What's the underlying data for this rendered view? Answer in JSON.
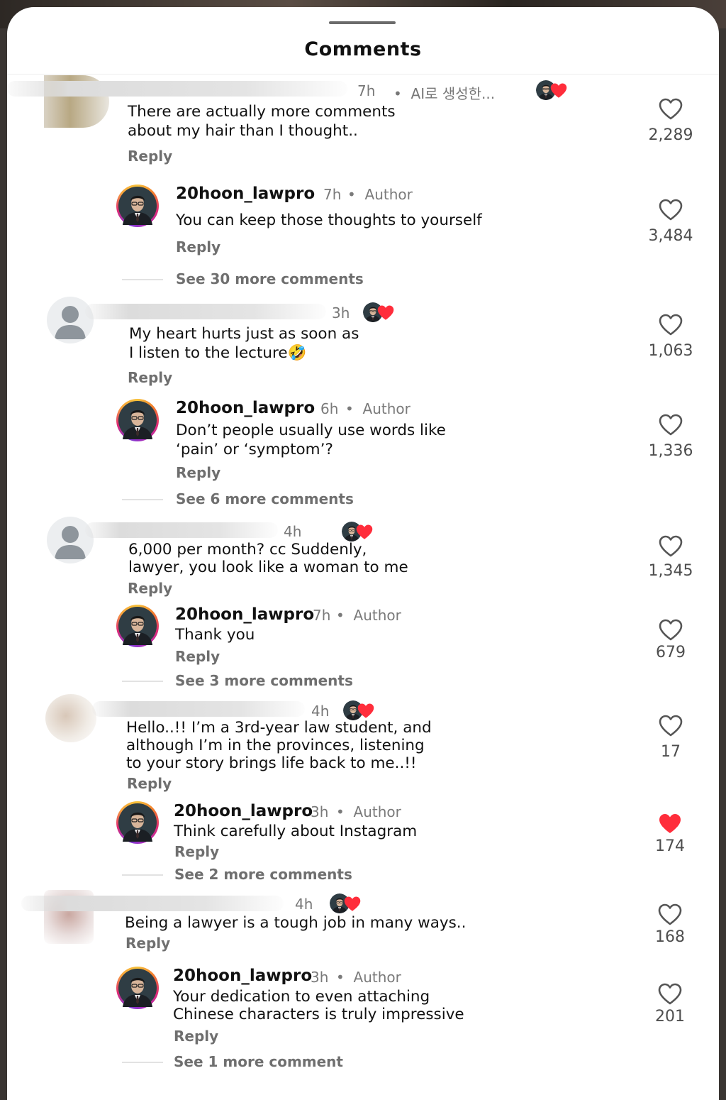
{
  "header": {
    "title": "Comments"
  },
  "threads": [
    {
      "comment": {
        "time": "7h",
        "ai_label": "AI로 생성한...",
        "text": "There are actually more comments\nabout my hair than I thought..",
        "reply": "Reply",
        "likes": "2,289"
      },
      "author_reply": {
        "username": "20hoon_lawpro",
        "time": "7h",
        "badge": "Author",
        "text": "You can keep those thoughts to yourself",
        "reply": "Reply",
        "likes": "3,484"
      },
      "see_more": "See 30 more comments"
    },
    {
      "comment": {
        "time": "3h",
        "text": "My heart hurts just as soon as\nI listen to the lecture🤣",
        "reply": "Reply",
        "likes": "1,063"
      },
      "author_reply": {
        "username": "20hoon_lawpro",
        "time": "6h",
        "badge": "Author",
        "text": "Don’t people usually use words like\n‘pain’ or ‘symptom’?",
        "reply": "Reply",
        "likes": "1,336"
      },
      "see_more": "See 6 more comments"
    },
    {
      "comment": {
        "time": "4h",
        "text": "6,000 per month? cc Suddenly,\nlawyer, you look like a woman to me",
        "reply": "Reply",
        "likes": "1,345"
      },
      "author_reply": {
        "username": "20hoon_lawpro",
        "time": "7h",
        "badge": "Author",
        "text": "Thank you",
        "reply": "Reply",
        "likes": "679"
      },
      "see_more": "See 3 more comments"
    },
    {
      "comment": {
        "time": "4h",
        "text": "Hello..!! I’m a 3rd-year law student, and\nalthough I’m in the provinces, listening\nto your story brings life back to me..!!",
        "reply": "Reply",
        "likes": "17"
      },
      "author_reply": {
        "username": "20hoon_lawpro",
        "time": "3h",
        "badge": "Author",
        "text": "Think carefully about Instagram",
        "reply": "Reply",
        "likes": "174",
        "liked": true
      },
      "see_more": "See 2 more comments"
    },
    {
      "comment": {
        "time": "4h",
        "text": "Being a lawyer is a tough job in many ways..",
        "reply": "Reply",
        "likes": "168"
      },
      "author_reply": {
        "username": "20hoon_lawpro",
        "time": "3h",
        "badge": "Author",
        "text": "Your dedication to even attaching\nChinese characters is truly impressive",
        "reply": "Reply",
        "likes": "201"
      },
      "see_more": "See 1 more comment"
    }
  ],
  "colors": {
    "liked_heart": "#ff2d3b",
    "muted_text": "#777777"
  },
  "icons": {
    "like": "heart-outline-icon",
    "liked": "heart-filled-icon",
    "creator_like": "creator-liked-icon"
  }
}
